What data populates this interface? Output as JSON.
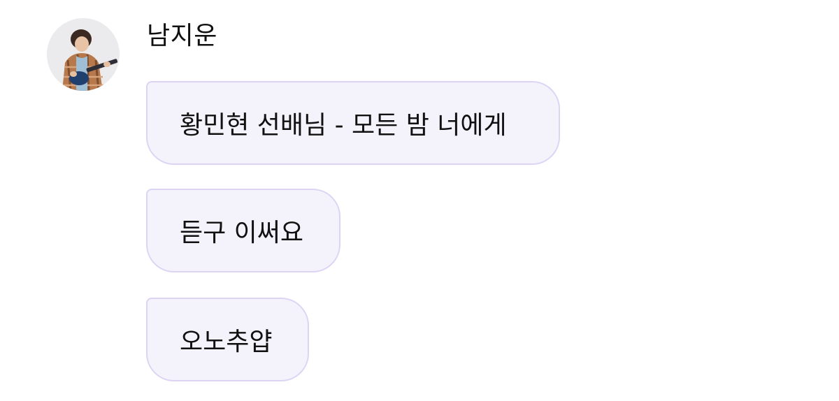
{
  "sender": {
    "name": "남지운",
    "avatar_icon": "profile-photo"
  },
  "messages": [
    {
      "text": "황민현 선배님 - 모든 밤 너에게"
    },
    {
      "text": "듣구 이써요"
    },
    {
      "text": "오노추얍"
    }
  ],
  "colors": {
    "background": "#ffffff",
    "bubble_fill": "#f4f2fb",
    "bubble_border": "#ddd4f4",
    "text": "#111111"
  }
}
